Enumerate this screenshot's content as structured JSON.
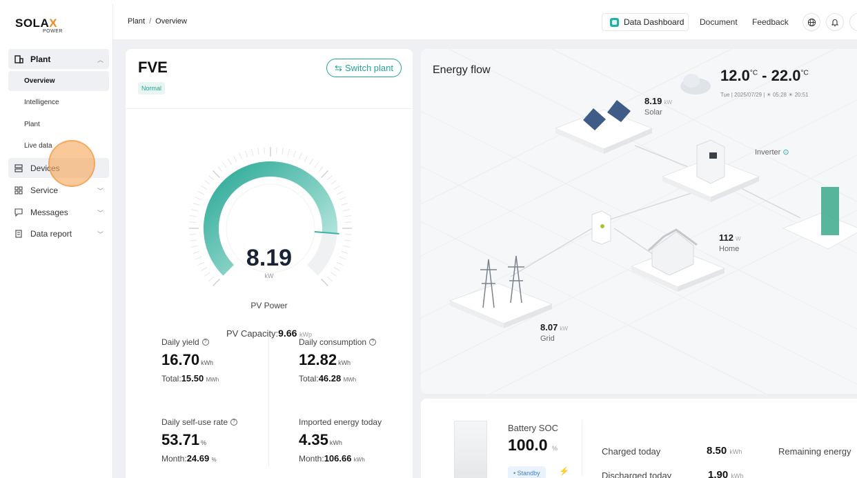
{
  "brand": {
    "logo_text": "SOLAX",
    "logo_sub": "POWER"
  },
  "sidebar": {
    "plant": {
      "label": "Plant",
      "subitems": [
        "Overview",
        "Intelligence",
        "Plant",
        "Live data"
      ]
    },
    "items": [
      {
        "label": "Devices"
      },
      {
        "label": "Service"
      },
      {
        "label": "Messages"
      },
      {
        "label": "Data report"
      }
    ]
  },
  "header": {
    "breadcrumb": [
      "Plant",
      "Overview"
    ],
    "dashboard_label": "Data Dashboard",
    "document_label": "Document",
    "feedback_label": "Feedback"
  },
  "plant": {
    "name": "FVE",
    "status": "Normal",
    "switch_label": "Switch plant",
    "pv_power": {
      "value": "8.19",
      "unit": "kW",
      "label": "PV Power",
      "fill_fraction": 0.85
    },
    "capacity": {
      "label": "PV Capacity:",
      "value": "9.66",
      "unit": "kWp"
    }
  },
  "stats": [
    {
      "label": "Daily yield",
      "value": "16.70",
      "unit": "kWh",
      "sub_label": "Total:",
      "sub_value": "15.50",
      "sub_unit": "MWh"
    },
    {
      "label": "Daily consumption",
      "value": "12.82",
      "unit": "kWh",
      "sub_label": "Total:",
      "sub_value": "46.28",
      "sub_unit": "MWh"
    },
    {
      "label": "Daily self-use rate",
      "value": "53.71",
      "unit": "%",
      "sub_label": "Month:",
      "sub_value": "24.69",
      "sub_unit": "%"
    },
    {
      "label": "Imported energy today",
      "value": "4.35",
      "unit": "kWh",
      "sub_label": "Month:",
      "sub_value": "106.66",
      "sub_unit": "kWh"
    }
  ],
  "energy_flow": {
    "title": "Energy flow",
    "temp_low": "12.0",
    "temp_high": "22.0",
    "temp_unit": "°C",
    "date_line": "Tue | 2025/07/29 | ☀ 05:28 ☀ 20:51",
    "solar": {
      "value": "8.19",
      "unit": "kW",
      "label": "Solar"
    },
    "inverter_label": "Inverter",
    "home": {
      "value": "112",
      "unit": "W",
      "label": "Home"
    },
    "grid": {
      "value": "8.07",
      "unit": "kW",
      "label": "Grid"
    }
  },
  "battery": {
    "soc_label": "Battery SOC",
    "soc_value": "100.0",
    "soc_unit": "%",
    "status": "Standby",
    "charged_label": "Charged today",
    "charged_value": "8.50",
    "charged_unit": "kWh",
    "discharged_label": "Discharged today",
    "discharged_value": "1.90",
    "discharged_unit": "kWh",
    "remaining_label": "Remaining energy"
  },
  "colors": {
    "accent": "#22a593",
    "brand_orange": "#f08a1c"
  }
}
